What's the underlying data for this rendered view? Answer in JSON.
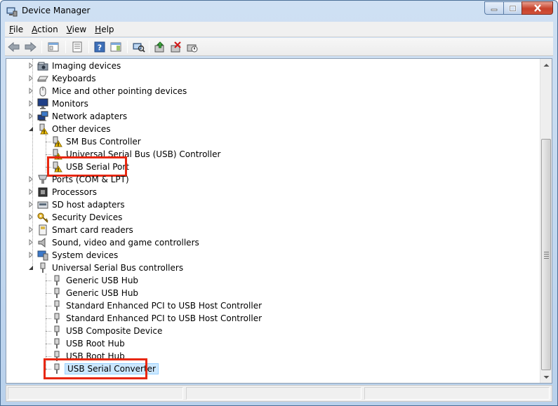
{
  "window": {
    "title": "Device Manager"
  },
  "menu": [
    {
      "label": "File",
      "mnemonic": "F",
      "rest": "ile"
    },
    {
      "label": "Action",
      "mnemonic": "A",
      "rest": "ction"
    },
    {
      "label": "View",
      "mnemonic": "V",
      "rest": "iew"
    },
    {
      "label": "Help",
      "mnemonic": "H",
      "rest": "elp"
    }
  ],
  "toolbar": {
    "buttons": [
      "back-icon",
      "forward-icon",
      "show-hide-console-tree-icon",
      "properties-icon",
      "help-icon",
      "action-pane-icon",
      "scan-hardware-icon",
      "update-driver-icon",
      "uninstall-icon",
      "disable-icon"
    ]
  },
  "tree": {
    "categories_top": [
      {
        "label": "Imaging devices",
        "icon": "imaging-icon",
        "expanded": false
      },
      {
        "label": "Keyboards",
        "icon": "keyboard-icon",
        "expanded": false
      },
      {
        "label": "Mice and other pointing devices",
        "icon": "mouse-icon",
        "expanded": false
      },
      {
        "label": "Monitors",
        "icon": "monitor-icon",
        "expanded": false
      },
      {
        "label": "Network adapters",
        "icon": "network-icon",
        "expanded": false
      }
    ],
    "other_devices": {
      "label": "Other devices",
      "expanded": true,
      "children": [
        "SM Bus Controller",
        "Universal Serial Bus (USB) Controller",
        "USB Serial Port"
      ]
    },
    "categories_mid": [
      {
        "label": "Ports (COM & LPT)",
        "icon": "port-icon",
        "expanded": false
      },
      {
        "label": "Processors",
        "icon": "processor-icon",
        "expanded": false
      },
      {
        "label": "SD host adapters",
        "icon": "sd-icon",
        "expanded": false
      },
      {
        "label": "Security Devices",
        "icon": "security-icon",
        "expanded": false
      },
      {
        "label": "Smart card readers",
        "icon": "smartcard-icon",
        "expanded": false
      },
      {
        "label": "Sound, video and game controllers",
        "icon": "sound-icon",
        "expanded": false
      },
      {
        "label": "System devices",
        "icon": "system-icon",
        "expanded": false
      }
    ],
    "usb_controllers": {
      "label": "Universal Serial Bus controllers",
      "expanded": true,
      "children": [
        "Generic USB Hub",
        "Generic USB Hub",
        "Standard Enhanced PCI to USB Host Controller",
        "Standard Enhanced PCI to USB Host Controller",
        "USB Composite Device",
        "USB Root Hub",
        "USB Root Hub",
        "USB Serial Converter"
      ]
    },
    "selected": "USB Serial Converter",
    "highlighted": [
      "USB Serial Port",
      "USB Serial Converter"
    ]
  },
  "colors": {
    "highlight_box": "#e8270f",
    "selection": "#cce8ff",
    "warning": "#f5c400"
  }
}
